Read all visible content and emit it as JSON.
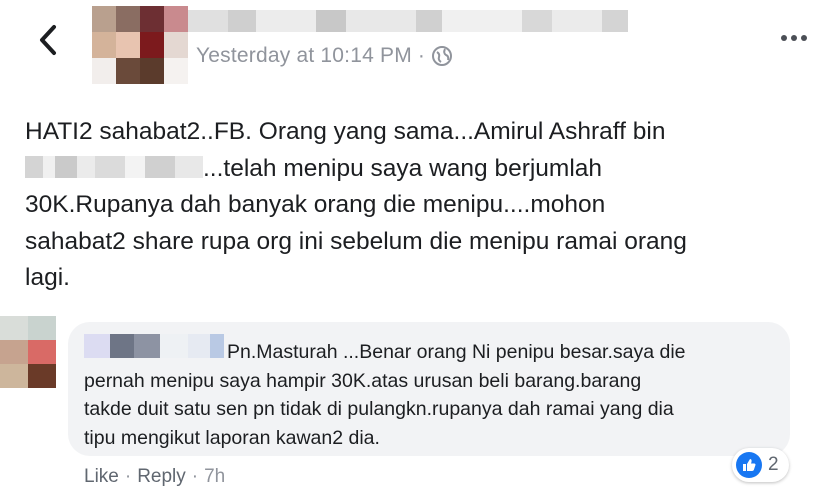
{
  "post": {
    "timestamp": "Yesterday at 10:14 PM",
    "separator": "·",
    "audience_icon": "globe-icon",
    "text_lines": {
      "l1": "HATI2 sahabat2..FB. Orang yang sama...Amirul Ashraff bin",
      "l2": "...telah menipu saya wang berjumlah",
      "l3": "30K.Rupanya dah banyak orang die menipu....mohon",
      "l4": "sahabat2 share rupa org ini sebelum die menipu ramai orang",
      "l5": "lagi."
    }
  },
  "comment": {
    "lines": {
      "l1": "Pn.Masturah ...Benar orang Ni penipu besar.saya die",
      "l2": "pernah menipu saya hampir 30K.atas urusan beli barang.barang",
      "l3": "takde duit satu sen pn tidak di pulangkn.rupanya dah ramai yang dia",
      "l4": "tipu mengikut laporan kawan2 dia."
    },
    "actions": {
      "like": "Like",
      "dot1": "·",
      "reply": "Reply",
      "dot2": "·",
      "time": "7h"
    },
    "reaction_count": "2"
  },
  "colors": {
    "accent": "#1877f2",
    "meta_gray": "#90949c",
    "bubble": "#f2f3f5"
  }
}
